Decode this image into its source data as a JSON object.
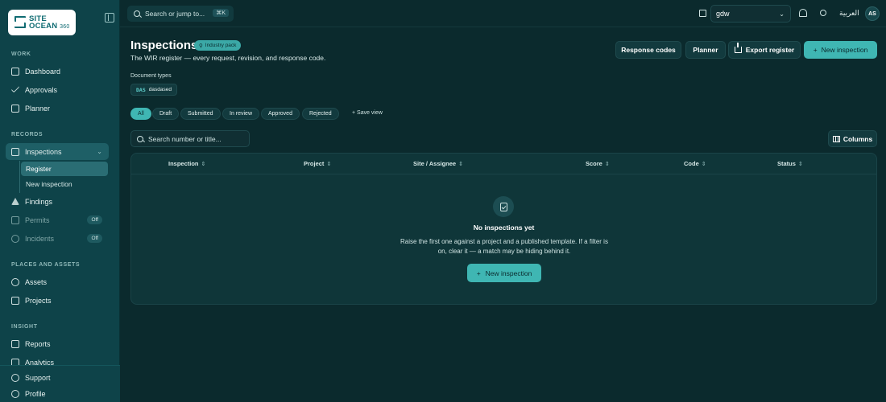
{
  "sidebar": {
    "logo": {
      "line1": "SITE",
      "line2": "OCEAN",
      "num": "360"
    },
    "sections": {
      "work": "WORK",
      "records": "RECORDS",
      "places": "PLACES AND ASSETS",
      "insight": "INSIGHT"
    },
    "items": {
      "dashboard": "Dashboard",
      "approvals": "Approvals",
      "planner": "Planner",
      "inspections": "Inspections",
      "register": "Register",
      "new_inspection": "New inspection",
      "findings": "Findings",
      "permits": "Permits",
      "incidents": "Incidents",
      "assets": "Assets",
      "projects": "Projects",
      "reports": "Reports",
      "analytics": "Analytics",
      "support": "Support",
      "profile": "Profile"
    },
    "off_badge": "Off"
  },
  "topbar": {
    "search_placeholder": "Search or jump to...",
    "search_shortcut": "⌘K",
    "org_value": "gdw",
    "language": "العربية",
    "avatar_initials": "AS"
  },
  "header": {
    "title": "Inspections",
    "badge": "Industry pack",
    "subtitle": "The WIR register — every request, revision, and response code.",
    "buttons": {
      "response_codes": "Response codes",
      "planner": "Planner",
      "export": "Export register",
      "new": "New inspection"
    }
  },
  "document_types": {
    "label": "Document types",
    "chip_code": "DAS",
    "chip_name": "dasdased"
  },
  "filters": [
    "All",
    "Draft",
    "Submitted",
    "In review",
    "Approved",
    "Rejected"
  ],
  "save_view": "+ Save view",
  "table": {
    "search_placeholder": "Search number or title...",
    "columns_button": "Columns",
    "columns": [
      "Inspection",
      "Project",
      "Site / Assignee",
      "Score",
      "Code",
      "Status"
    ],
    "sort_glyph": "⇕"
  },
  "empty_state": {
    "title": "No inspections yet",
    "description": "Raise the first one against a project and a published template. If a filter is on, clear it — a match may be hiding behind it.",
    "button": "New inspection"
  },
  "colors": {
    "accent": "#3fb6b3",
    "sidebar": "#0e4349",
    "background": "#0b2a2d"
  }
}
